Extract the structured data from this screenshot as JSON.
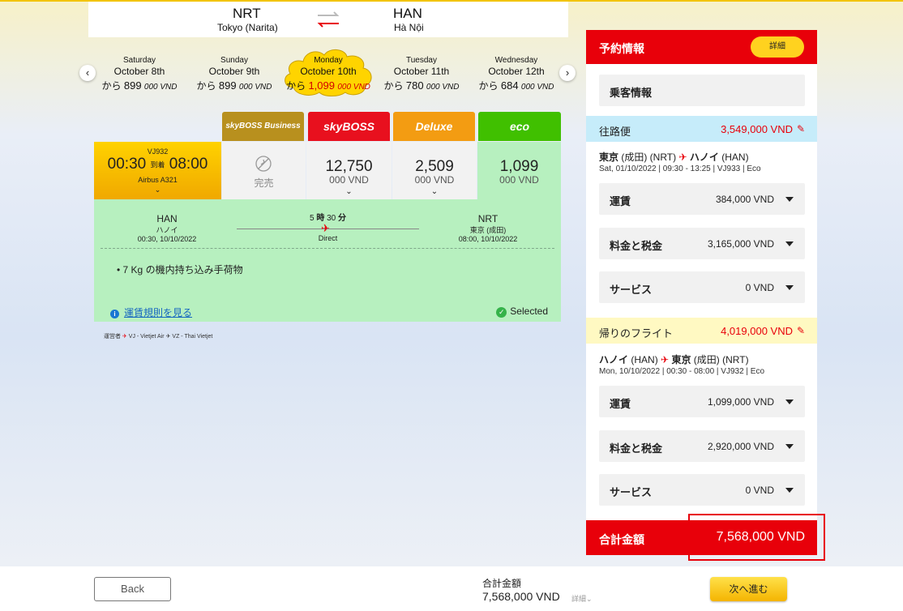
{
  "route": {
    "origin_code": "NRT",
    "origin_city": "Tokyo (Narita)",
    "destination_code": "HAN",
    "destination_city": "Hà Nội"
  },
  "dates": [
    {
      "weekday": "Saturday",
      "date": "October 8th",
      "prefix": "から",
      "price_main": "899",
      "price_rest": "000 VND"
    },
    {
      "weekday": "Sunday",
      "date": "October 9th",
      "prefix": "から",
      "price_main": "899",
      "price_rest": "000 VND"
    },
    {
      "weekday": "Monday",
      "date": "October 10th",
      "prefix": "から",
      "price_main": "1,099",
      "price_rest": "000 VND",
      "selected": true
    },
    {
      "weekday": "Tuesday",
      "date": "October 11th",
      "prefix": "から",
      "price_main": "780",
      "price_rest": "000 VND"
    },
    {
      "weekday": "Wednesday",
      "date": "October 12th",
      "prefix": "から",
      "price_main": "684",
      "price_rest": "000 VND"
    }
  ],
  "fare_classes": [
    {
      "label": "skyBOSS Business",
      "color": "#b8901e"
    },
    {
      "label": "skyBOSS",
      "color": "#e8101e"
    },
    {
      "label": "Deluxe",
      "color": "#f39c12"
    },
    {
      "label": "eco",
      "color": "#40c000"
    }
  ],
  "flight": {
    "number": "VJ932",
    "depart": "00:30",
    "arrive_label": "到着",
    "arrive": "08:00",
    "aircraft": "Airbus A321",
    "chevron": "⌄"
  },
  "fares": {
    "soldout_label": "完売",
    "skyboss": {
      "amount": "12,750",
      "currency": "000 VND"
    },
    "deluxe": {
      "amount": "2,509",
      "currency": "000 VND"
    },
    "eco": {
      "amount": "1,099",
      "currency": "000 VND"
    }
  },
  "detail": {
    "from_code": "HAN",
    "from_city": "ハノイ",
    "from_time": "00:30, 10/10/2022",
    "duration_h": "5",
    "duration_h_label": "時",
    "duration_m": "30",
    "duration_m_label": "分",
    "direct": "Direct",
    "to_code": "NRT",
    "to_city": "東京 (成田)",
    "to_time": "08:00, 10/10/2022",
    "baggage": "7 Kg の機内持ち込み手荷物",
    "rules_link": "運賃規則を見る",
    "selected": "Selected"
  },
  "operators": {
    "prefix": "運営者",
    "vj": "VJ - Vietjet Air",
    "vz": "VZ - Thai Vietjet"
  },
  "booking": {
    "title": "予約情報",
    "details_button": "詳細",
    "passenger": "乗客情報",
    "outbound": {
      "label": "往路便",
      "price": "3,549,000 VND",
      "from": "東京",
      "from_code": "(成田) (NRT)",
      "to": "ハノイ",
      "to_code": "(HAN)",
      "summary": "Sat, 01/10/2022 | 09:30 - 13:25 | VJ933 | Eco",
      "fare_label": "運賃",
      "fare": "384,000 VND",
      "tax_label": "料金と税金",
      "tax": "3,165,000 VND",
      "service_label": "サービス",
      "service": "0 VND"
    },
    "return": {
      "label": "帰りのフライト",
      "price": "4,019,000 VND",
      "from": "ハノイ",
      "from_code": "(HAN)",
      "to": "東京",
      "to_code": "(成田) (NRT)",
      "summary": "Mon, 10/10/2022 | 00:30 - 08:00 | VJ932 | Eco",
      "fare_label": "運賃",
      "fare": "1,099,000 VND",
      "tax_label": "料金と税金",
      "tax": "2,920,000 VND",
      "service_label": "サービス",
      "service": "0 VND"
    },
    "total_label": "合計金額",
    "total": "7,568,000 VND"
  },
  "footer": {
    "back": "Back",
    "total_label": "合計金額",
    "total": "7,568,000 VND",
    "details": "詳細⌄",
    "next": "次へ進む"
  },
  "colors": {
    "accent_red": "#e8000a",
    "accent_yellow": "#ffd21f",
    "selected_green": "#b7f0bf",
    "outbound_band": "#c6ecfa",
    "return_band": "#fff9c2"
  }
}
